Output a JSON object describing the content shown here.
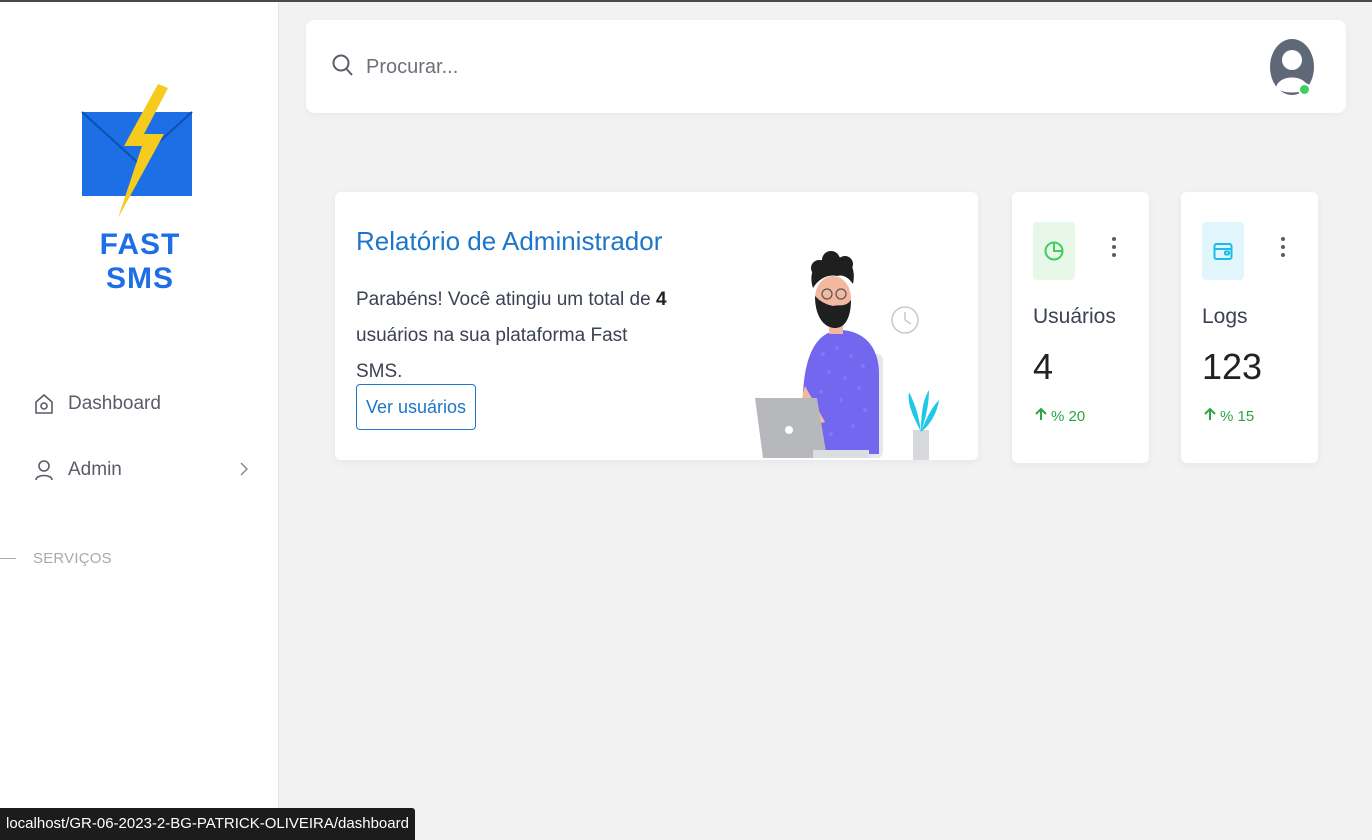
{
  "app": {
    "brand": "FAST SMS",
    "brand_color": "#1d6fe6",
    "accent_color": "#1d76c9"
  },
  "sidebar": {
    "items": [
      {
        "label": "Dashboard",
        "icon": "home-icon"
      },
      {
        "label": "Admin",
        "icon": "user-icon",
        "has_submenu": true
      }
    ],
    "section_header": "SERVIÇOS"
  },
  "topbar": {
    "search_placeholder": "Procurar...",
    "search_value": "",
    "avatar_status": "online",
    "status_color": "#3ecf5f"
  },
  "report": {
    "title": "Relatório de Administrador",
    "text_before": "Parabéns! Você atingiu um total de ",
    "count": "4",
    "text_after": " usuários na sua plataforma Fast SMS.",
    "button_label": "Ver usuários"
  },
  "stats": [
    {
      "title": "Usuários",
      "value": "4",
      "change": "% 20",
      "icon": "pie-chart-icon",
      "icon_bg": "#e8f8e8",
      "icon_color": "#3ecf5f"
    },
    {
      "title": "Logs",
      "value": "123",
      "change": "% 15",
      "icon": "wallet-icon",
      "icon_bg": "#e0f6fc",
      "icon_color": "#18bde8"
    }
  ],
  "statusbar": {
    "url": "localhost/GR-06-2023-2-BG-PATRICK-OLIVEIRA/dashboard"
  }
}
